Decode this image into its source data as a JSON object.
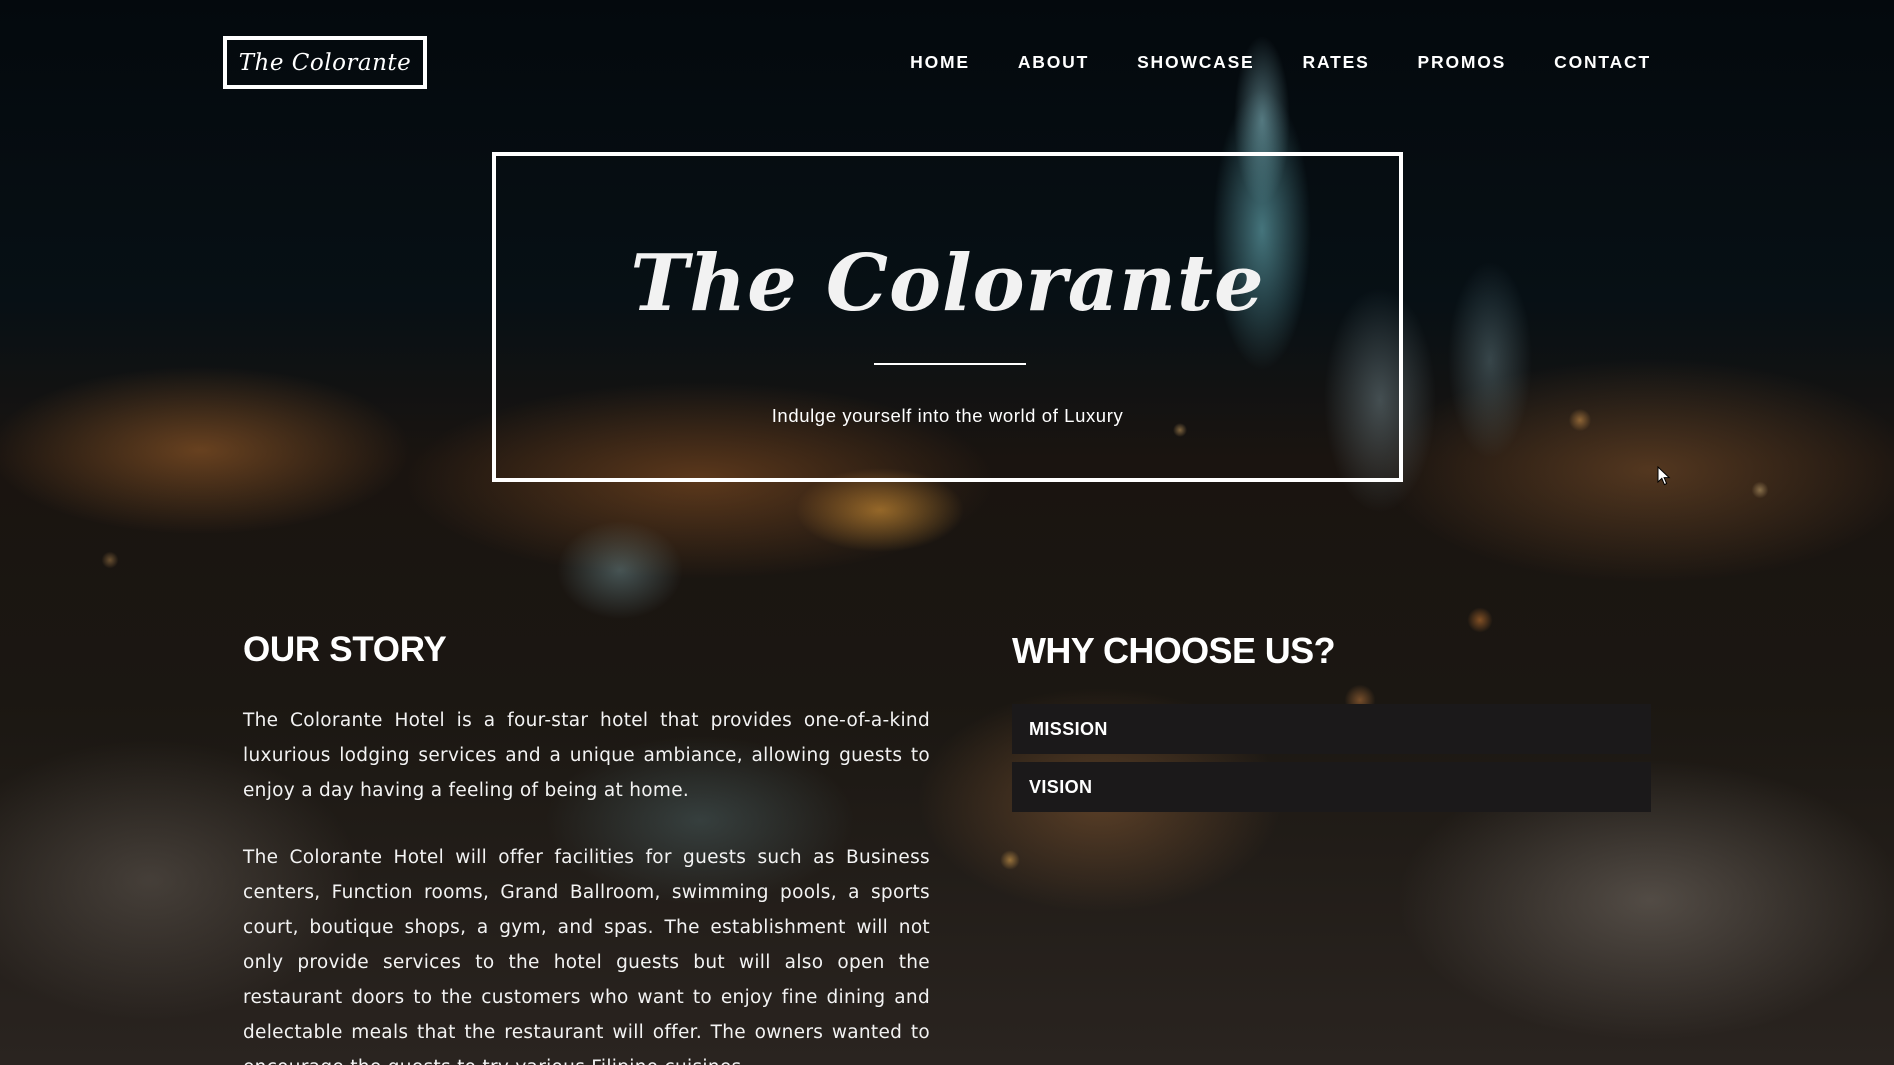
{
  "header": {
    "logo_text": "The Colorante",
    "nav": [
      {
        "label": "HOME"
      },
      {
        "label": "ABOUT"
      },
      {
        "label": "SHOWCASE"
      },
      {
        "label": "RATES"
      },
      {
        "label": "PROMOS"
      },
      {
        "label": "CONTACT"
      }
    ]
  },
  "hero": {
    "title": "The Colorante",
    "tagline": "Indulge yourself into the world of Luxury"
  },
  "story": {
    "heading": "OUR STORY",
    "paragraph1": "The Colorante Hotel is a four-star hotel that provides one-of-a-kind luxurious lodging services and a unique ambiance, allowing guests to enjoy a day having a feeling of being at home.",
    "paragraph2": "The Colorante Hotel will offer facilities for guests such as Business centers, Function rooms, Grand Ballroom, swimming pools, a sports court, boutique shops, a gym, and spas. The establishment will not only provide services to the hotel guests but will also open the restaurant doors to the customers who want to enjoy fine dining and delectable meals that the restaurant will offer. The owners wanted to encourage the guests to try various Filipino cuisines."
  },
  "why": {
    "heading": "WHY CHOOSE US?",
    "items": [
      {
        "label": "MISSION"
      },
      {
        "label": "VISION"
      }
    ]
  },
  "colors": {
    "text": "#ffffff",
    "accordion_bg": "#1b191a",
    "page_bg": "#06090d"
  },
  "icons": {
    "cursor": "mouse-pointer-icon"
  }
}
